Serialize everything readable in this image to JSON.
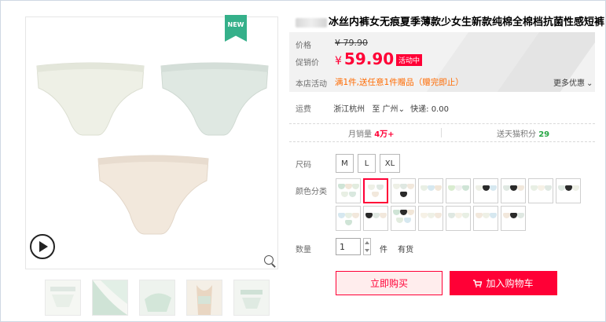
{
  "product": {
    "title": "冰丝内裤女无痕夏季薄款少女生新款纯棉全棉档抗菌性感短裤",
    "new_badge": "NEW"
  },
  "price": {
    "label": "价格",
    "original": "¥ 79.90",
    "promo_label": "促销价",
    "currency": "¥",
    "promo_value": "59.90",
    "promo_tag": "活动中",
    "store_promo_label": "本店活动",
    "store_promo_text": "满1件,送任意1件赠品（赠完即止）",
    "more_offers": "更多优惠"
  },
  "shipping": {
    "label": "运费",
    "from": "浙江杭州",
    "to_text": "至 广州",
    "express": "快递: 0.00"
  },
  "stats": {
    "monthly_sales_label": "月销量",
    "monthly_sales_value": "4万+",
    "points_label": "送天猫积分",
    "points_value": "29"
  },
  "options": {
    "size_label": "尺码",
    "sizes": [
      "M",
      "L",
      "XL"
    ],
    "color_label": "颜色分类"
  },
  "quantity": {
    "label": "数量",
    "value": "1",
    "unit": "件",
    "stock": "有货"
  },
  "actions": {
    "buy_now": "立即购买",
    "add_to_cart": "加入购物车"
  },
  "colors": {
    "accent": "#ff0036",
    "promo_orange": "#ff6a00",
    "new_badge": "#35b08a"
  }
}
